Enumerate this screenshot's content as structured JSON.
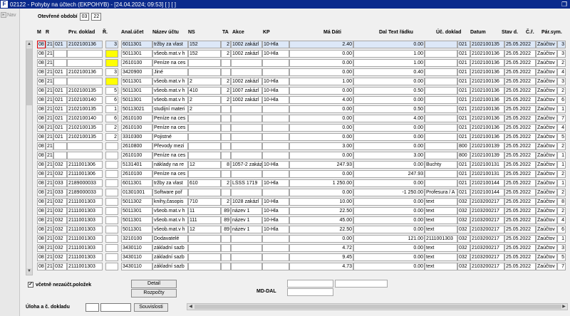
{
  "window": {
    "title": "02122 - Pohyby na účtech (EKPOHYB) - [24.04.2024; 09:53]  [ ]  [ ]",
    "app_icon_glyph": "F",
    "restore_icon": "❐"
  },
  "nav": {
    "label": "Nav"
  },
  "period": {
    "label": "Otevřené období",
    "year": "03",
    "month": "22"
  },
  "columns": {
    "m": "M",
    "r": "R",
    "prv_doklad": "Prv. doklad",
    "poradi": "Ř.",
    "anal_ucet": "Anal.účet",
    "nazev_uctu": "Název účtu",
    "ns": "NS",
    "ta": "TA",
    "akce": "Akce",
    "kp": "KP",
    "ma_dati": "Má Dáti",
    "dal": "Dal",
    "text_radku": "Text řádku",
    "uc_doklad": "Úč. doklad",
    "datum": "Datum",
    "stav_d": "Stav d.",
    "c_r": "Č.ř.",
    "par_sym": "Pár.sym."
  },
  "rows": [
    {
      "m": "08",
      "r": "21",
      "c3": "021",
      "prv": "2102100136",
      "ord": "3",
      "acc": "6011301",
      "name": "tržby za vlast",
      "ns": "152",
      "ta": "2",
      "akce": "1002 zakázl",
      "kp": "10-Hla",
      "ma": "2.40",
      "dal": "0.00",
      "text": "",
      "c021": "021",
      "doc": "2102100135",
      "date": "25.05.2022",
      "stav": "Zaúčtov",
      "cr": "3",
      "yellow": false
    },
    {
      "m": "08",
      "r": "21",
      "c3": "",
      "prv": "",
      "ord": "",
      "acc": "5011301",
      "name": "všeob.mat.v h",
      "ns": "152",
      "ta": "2",
      "akce": "1002 zakázl",
      "kp": "10-Hla",
      "ma": "0.00",
      "dal": "1.00",
      "text": "",
      "c021": "021",
      "doc": "2102100136",
      "date": "25.05.2022",
      "stav": "Zaúčtov",
      "cr": "3",
      "yellow": true
    },
    {
      "m": "08",
      "r": "21",
      "c3": "",
      "prv": "",
      "ord": "",
      "acc": "2610100",
      "name": "Peníze na ces",
      "ns": "",
      "ta": "",
      "akce": "",
      "kp": "",
      "ma": "0.00",
      "dal": "1.00",
      "text": "",
      "c021": "021",
      "doc": "2102100136",
      "date": "25.05.2022",
      "stav": "Zaúčtov",
      "cr": "2",
      "yellow": true
    },
    {
      "m": "08",
      "r": "21",
      "c3": "021",
      "prv": "2102100136",
      "ord": "3",
      "acc": "3420900",
      "name": "Jiné",
      "ns": "",
      "ta": "",
      "akce": "",
      "kp": "",
      "ma": "0.00",
      "dal": "0.40",
      "text": "",
      "c021": "021",
      "doc": "2102100136",
      "date": "25.05.2022",
      "stav": "Zaúčtov",
      "cr": "4",
      "yellow": false
    },
    {
      "m": "08",
      "r": "21",
      "c3": "",
      "prv": "",
      "ord": "",
      "acc": "5011301",
      "name": "všeob.mat.v h",
      "ns": "2",
      "ta": "2",
      "akce": "1002 zakázl",
      "kp": "10-Hla",
      "ma": "1.00",
      "dal": "0.00",
      "text": "",
      "c021": "021",
      "doc": "2102100136",
      "date": "25.05.2022",
      "stav": "Zaúčtov",
      "cr": "3",
      "yellow": true
    },
    {
      "m": "08",
      "r": "21",
      "c3": "021",
      "prv": "2102100135",
      "ord": "5",
      "acc": "5011301",
      "name": "všeob.mat.v h",
      "ns": "410",
      "ta": "2",
      "akce": "1007 zakázl",
      "kp": "10-Hla",
      "ma": "0.00",
      "dal": "0.50",
      "text": "",
      "c021": "021",
      "doc": "2102100136",
      "date": "25.05.2022",
      "stav": "Zaúčtov",
      "cr": "2",
      "yellow": false
    },
    {
      "m": "08",
      "r": "21",
      "c3": "021",
      "prv": "2102100140",
      "ord": "6",
      "acc": "5011301",
      "name": "všeob.mat.v h",
      "ns": "2",
      "ta": "2",
      "akce": "1002 zakázl",
      "kp": "10-Hla",
      "ma": "4.00",
      "dal": "0.00",
      "text": "",
      "c021": "021",
      "doc": "2102100136",
      "date": "25.05.2022",
      "stav": "Zaúčtov",
      "cr": "6",
      "yellow": false
    },
    {
      "m": "08",
      "r": "21",
      "c3": "021",
      "prv": "2102100135",
      "ord": "1",
      "acc": "50113021",
      "name": "studijní materi",
      "ns": "2",
      "ta": "",
      "akce": "",
      "kp": "",
      "ma": "0.00",
      "dal": "0.50",
      "text": "",
      "c021": "021",
      "doc": "2102100136",
      "date": "25.05.2022",
      "stav": "Zaúčtov",
      "cr": "1",
      "yellow": false
    },
    {
      "m": "08",
      "r": "21",
      "c3": "021",
      "prv": "2102100140",
      "ord": "6",
      "acc": "2610100",
      "name": "Peníze na ces",
      "ns": "",
      "ta": "",
      "akce": "",
      "kp": "",
      "ma": "0.00",
      "dal": "4.00",
      "text": "",
      "c021": "021",
      "doc": "2102100136",
      "date": "25.05.2022",
      "stav": "Zaúčtov",
      "cr": "7",
      "yellow": false
    },
    {
      "m": "08",
      "r": "21",
      "c3": "021",
      "prv": "2102100135",
      "ord": "2",
      "acc": "2610100",
      "name": "Peníze na ces",
      "ns": "",
      "ta": "",
      "akce": "",
      "kp": "",
      "ma": "0.00",
      "dal": "0.00",
      "text": "",
      "c021": "021",
      "doc": "2102100136",
      "date": "25.05.2022",
      "stav": "Zaúčtov",
      "cr": "4",
      "yellow": false
    },
    {
      "m": "08",
      "r": "21",
      "c3": "021",
      "prv": "2102100135",
      "ord": "2",
      "acc": "3310300",
      "name": "Pojistné",
      "ns": "",
      "ta": "",
      "akce": "",
      "kp": "",
      "ma": "0.00",
      "dal": "0.00",
      "text": "",
      "c021": "021",
      "doc": "2102100136",
      "date": "25.05.2022",
      "stav": "Zaúčtov",
      "cr": "5",
      "yellow": false
    },
    {
      "m": "08",
      "r": "21",
      "c3": "",
      "prv": "",
      "ord": "",
      "acc": "2610800",
      "name": "Převody mezi",
      "ns": "",
      "ta": "",
      "akce": "",
      "kp": "",
      "ma": "3.00",
      "dal": "0.00",
      "text": "",
      "c021": "800",
      "doc": "2102100139",
      "date": "25.05.2022",
      "stav": "Zaúčtov",
      "cr": "2",
      "yellow": false
    },
    {
      "m": "08",
      "r": "21",
      "c3": "",
      "prv": "",
      "ord": "",
      "acc": "2610100",
      "name": "Peníze na ces",
      "ns": "",
      "ta": "",
      "akce": "",
      "kp": "",
      "ma": "0.00",
      "dal": "3.00",
      "text": "",
      "c021": "800",
      "doc": "2102100139",
      "date": "25.05.2022",
      "stav": "Zaúčtov",
      "cr": "1",
      "yellow": false
    },
    {
      "m": "08",
      "r": "21",
      "c3": "032",
      "prv": "2111001306",
      "ord": "",
      "acc": "5131401",
      "name": "náklady na re",
      "ns": "12",
      "ta": "8",
      "akce": "1057-2 zakáz",
      "kp": "10-Hla",
      "ma": "247.93",
      "dal": "0.00",
      "text": "Buchty",
      "c021": "021",
      "doc": "2102100131",
      "date": "25.05.2022",
      "stav": "Zaúčtov",
      "cr": "1",
      "yellow": false
    },
    {
      "m": "08",
      "r": "21",
      "c3": "032",
      "prv": "2111001306",
      "ord": "",
      "acc": "2610100",
      "name": "Peníze na ces",
      "ns": "",
      "ta": "",
      "akce": "",
      "kp": "",
      "ma": "0.00",
      "dal": "247.93",
      "text": "",
      "c021": "021",
      "doc": "2102100131",
      "date": "25.05.2022",
      "stav": "Zaúčtov",
      "cr": "2",
      "yellow": false
    },
    {
      "m": "08",
      "r": "21",
      "c3": "033",
      "prv": "2189000033",
      "ord": "",
      "acc": "6011301",
      "name": "tržby za vlast",
      "ns": "610",
      "ta": "2",
      "akce": "LŠSS 1719",
      "kp": "10-Hla",
      "ma": "1 250.00",
      "dal": "0.00",
      "text": "",
      "c021": "021",
      "doc": "2102100144",
      "date": "25.05.2022",
      "stav": "Zaúčtov",
      "cr": "1",
      "yellow": false
    },
    {
      "m": "08",
      "r": "21",
      "c3": "033",
      "prv": "2189000033",
      "ord": "",
      "acc": "01301001",
      "name": "Software poř",
      "ns": "",
      "ta": "",
      "akce": "",
      "kp": "",
      "ma": "0.00",
      "dal": "-1 250.00",
      "text": "Profesura / A",
      "c021": "021",
      "doc": "2102100144",
      "date": "25.05.2022",
      "stav": "Zaúčtov",
      "cr": "2",
      "yellow": false
    },
    {
      "m": "08",
      "r": "21",
      "c3": "032",
      "prv": "2111001303",
      "ord": "",
      "acc": "5011302",
      "name": "knihy,časopis",
      "ns": "710",
      "ta": "2",
      "akce": "1028 zakázl",
      "kp": "10-Hla",
      "ma": "10.00",
      "dal": "0.00",
      "text": "text",
      "c021": "032",
      "doc": "2103200217",
      "date": "25.05.2022",
      "stav": "Zaúčtov",
      "cr": "8",
      "yellow": false
    },
    {
      "m": "08",
      "r": "21",
      "c3": "032",
      "prv": "2111001303",
      "ord": "",
      "acc": "5011301",
      "name": "všeob.mat.v h",
      "ns": "11",
      "ta": "89",
      "akce": "název 1",
      "kp": "10-Hla",
      "ma": "22.50",
      "dal": "0.00",
      "text": "text",
      "c021": "032",
      "doc": "2103200217",
      "date": "25.05.2022",
      "stav": "Zaúčtov",
      "cr": "2",
      "yellow": false
    },
    {
      "m": "08",
      "r": "21",
      "c3": "032",
      "prv": "2111001303",
      "ord": "",
      "acc": "5011301",
      "name": "všeob.mat.v h",
      "ns": "111",
      "ta": "89",
      "akce": "název 1",
      "kp": "10-Hla",
      "ma": "45.00",
      "dal": "0.00",
      "text": "text",
      "c021": "032",
      "doc": "2103200217",
      "date": "25.05.2022",
      "stav": "Zaúčtov",
      "cr": "4",
      "yellow": false
    },
    {
      "m": "08",
      "r": "21",
      "c3": "032",
      "prv": "2111001303",
      "ord": "",
      "acc": "5011301",
      "name": "všeob.mat.v h",
      "ns": "12",
      "ta": "89",
      "akce": "název 1",
      "kp": "10-Hla",
      "ma": "22.50",
      "dal": "0.00",
      "text": "text",
      "c021": "032",
      "doc": "2103200217",
      "date": "25.05.2022",
      "stav": "Zaúčtov",
      "cr": "6",
      "yellow": false
    },
    {
      "m": "08",
      "r": "21",
      "c3": "032",
      "prv": "2111001303",
      "ord": "",
      "acc": "3210100",
      "name": "Dodavatelé",
      "ns": "",
      "ta": "",
      "akce": "",
      "kp": "",
      "ma": "0.00",
      "dal": "121.00",
      "text": "2111001303",
      "c021": "032",
      "doc": "2103200217",
      "date": "25.05.2022",
      "stav": "Zaúčtov",
      "cr": "1",
      "yellow": false
    },
    {
      "m": "08",
      "r": "21",
      "c3": "032",
      "prv": "2111001303",
      "ord": "",
      "acc": "3430110",
      "name": "základní sazb",
      "ns": "",
      "ta": "",
      "akce": "",
      "kp": "",
      "ma": "4.72",
      "dal": "0.00",
      "text": "text",
      "c021": "032",
      "doc": "2103200217",
      "date": "25.05.2022",
      "stav": "Zaúčtov",
      "cr": "3",
      "yellow": false
    },
    {
      "m": "08",
      "r": "21",
      "c3": "032",
      "prv": "2111001303",
      "ord": "",
      "acc": "3430110",
      "name": "základní sazb",
      "ns": "",
      "ta": "",
      "akce": "",
      "kp": "",
      "ma": "9.45",
      "dal": "0.00",
      "text": "text",
      "c021": "032",
      "doc": "2103200217",
      "date": "25.05.2022",
      "stav": "Zaúčtov",
      "cr": "5",
      "yellow": false
    },
    {
      "m": "08",
      "r": "21",
      "c3": "032",
      "prv": "2111001303",
      "ord": "",
      "acc": "3430110",
      "name": "základní sazb",
      "ns": "",
      "ta": "",
      "akce": "",
      "kp": "",
      "ma": "4.73",
      "dal": "0.00",
      "text": "text",
      "c021": "032",
      "doc": "2103200217",
      "date": "25.05.2022",
      "stav": "Zaúčtov",
      "cr": "7",
      "yellow": false
    }
  ],
  "footer": {
    "checkbox_label": "včetně nezaúčt.položek",
    "checkbox_mark": "✓",
    "detail_button": "Detail",
    "rozpocty_button": "Rozpočty",
    "mddal_label": "MD-DAL",
    "uloha_label": "Úloha a č. dokladu",
    "souvislosti_button": "Souvislosti"
  }
}
